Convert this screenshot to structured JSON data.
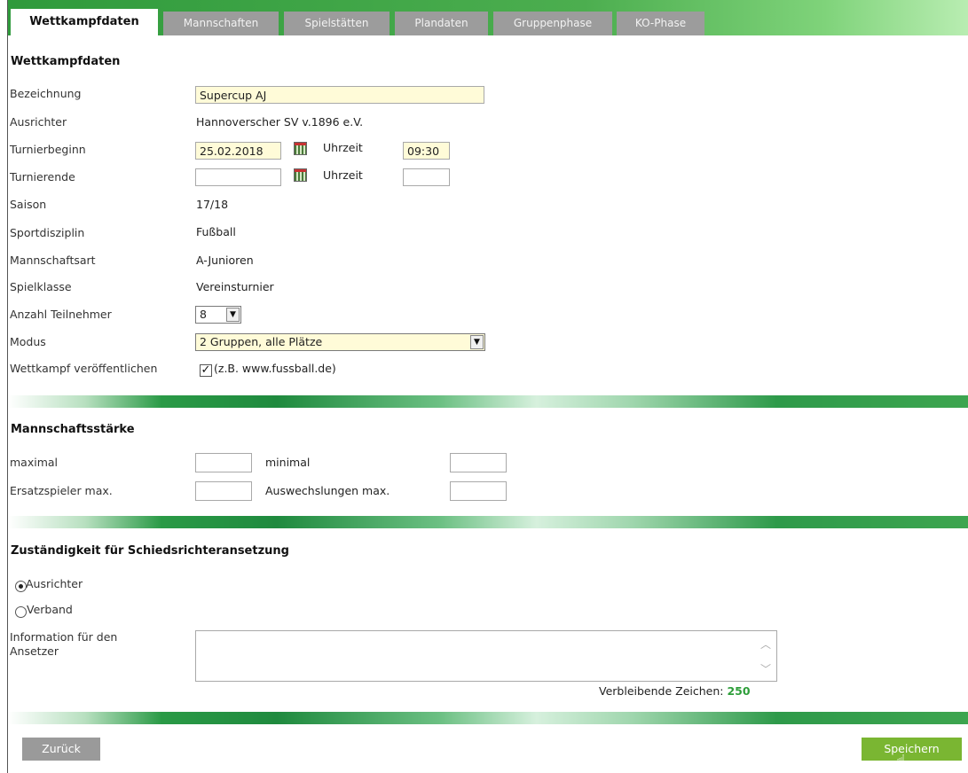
{
  "tabs": [
    {
      "label": "Wettkampfdaten",
      "active": true
    },
    {
      "label": "Mannschaften",
      "active": false
    },
    {
      "label": "Spielstätten",
      "active": false
    },
    {
      "label": "Plandaten",
      "active": false
    },
    {
      "label": "Gruppenphase",
      "active": false
    },
    {
      "label": "KO-Phase",
      "active": false
    }
  ],
  "wettkampf": {
    "title": "Wettkampfdaten",
    "bezeichnung_label": "Bezeichnung",
    "bezeichnung_value": "Supercup AJ",
    "ausrichter_label": "Ausrichter",
    "ausrichter_value": "Hannoverscher SV v.1896 e.V.",
    "turnierbeginn_label": "Turnierbeginn",
    "turnierbeginn_date": "25.02.2018",
    "uhrzeit_label": "Uhrzeit",
    "turnierbeginn_time": "09:30",
    "turnierende_label": "Turnierende",
    "turnierende_date": "",
    "turnierende_time": "",
    "saison_label": "Saison",
    "saison_value": "17/18",
    "sportdisziplin_label": "Sportdisziplin",
    "sportdisziplin_value": "Fußball",
    "mannschaftsart_label": "Mannschaftsart",
    "mannschaftsart_value": "A-Junioren",
    "spielklasse_label": "Spielklasse",
    "spielklasse_value": "Vereinsturnier",
    "teilnehmer_label": "Anzahl Teilnehmer",
    "teilnehmer_value": "8",
    "modus_label": "Modus",
    "modus_value": "2 Gruppen, alle Plätze",
    "veroeffentlichen_label": "Wettkampf veröffentlichen",
    "veroeffentlichen_checked": true,
    "veroeffentlichen_hint": "(z.B. www.fussball.de)"
  },
  "staerke": {
    "title": "Mannschaftsstärke",
    "maximal_label": "maximal",
    "minimal_label": "minimal",
    "ersatz_label": "Ersatzspieler max.",
    "auswechslungen_label": "Auswechslungen max.",
    "maximal_value": "",
    "minimal_value": "",
    "ersatz_value": "",
    "auswechslungen_value": ""
  },
  "schiri": {
    "title": "Zuständigkeit für Schiedsrichteransetzung",
    "option_ausrichter": "Ausrichter",
    "option_verband": "Verband",
    "selected": "Ausrichter",
    "info_label_1": "Information für den",
    "info_label_2": "Ansetzer",
    "info_value": "",
    "remaining_label": "Verbleibende Zeichen:",
    "remaining_count": "250"
  },
  "footer": {
    "back_label": "Zurück",
    "save_label": "Speichern"
  },
  "colors": {
    "tab_inactive": "#9c9c9c",
    "brand_green": "#2f9a3c",
    "save_button": "#7ab632",
    "back_button": "#9a9a9a",
    "input_highlight": "#fffbd8",
    "counter_green": "#2e9e3a"
  },
  "icons": [
    "calendar-icon",
    "chevron-down-icon",
    "checkmark-icon",
    "scroll-up-icon",
    "scroll-down-icon",
    "hand-cursor-icon"
  ]
}
